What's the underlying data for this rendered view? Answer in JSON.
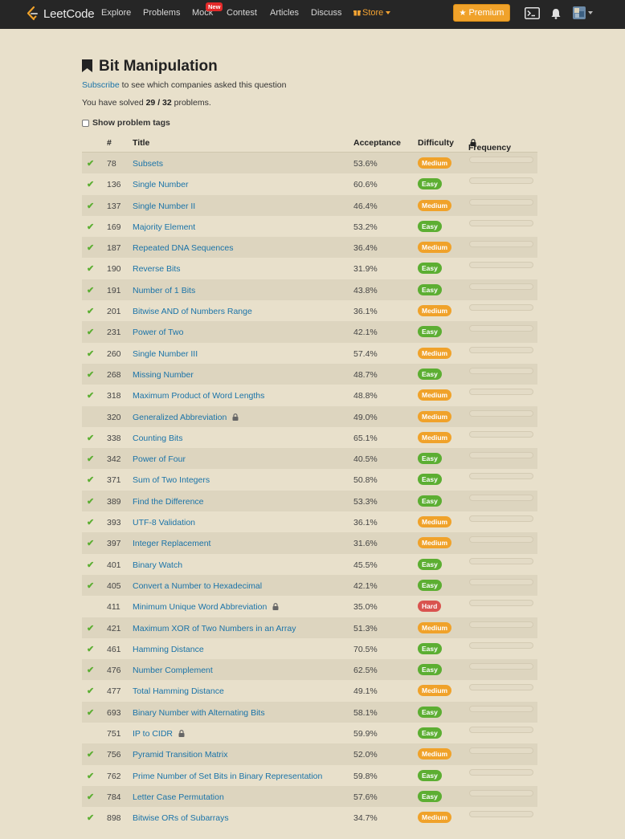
{
  "nav": {
    "brand": "LeetCode",
    "links": [
      "Explore",
      "Problems",
      "Mock",
      "Contest",
      "Articles",
      "Discuss"
    ],
    "new_badge": "New",
    "store": "Store",
    "premium": "Premium",
    "icons": [
      "console-icon",
      "bell-icon",
      "avatar"
    ]
  },
  "page": {
    "title": "Bit Manipulation",
    "subscribe_link": "Subscribe",
    "subscribe_rest": " to see which companies asked this question",
    "solved_prefix": "You have solved ",
    "solved_count": "29 / 32",
    "solved_suffix": " problems.",
    "show_tags": "Show problem tags"
  },
  "table": {
    "headers": {
      "num": "#",
      "title": "Title",
      "acceptance": "Acceptance",
      "difficulty": "Difficulty",
      "frequency": "Frequency"
    },
    "rows": [
      {
        "solved": true,
        "num": "78",
        "title": "Subsets",
        "locked": false,
        "acceptance": "53.6%",
        "difficulty": "Medium"
      },
      {
        "solved": true,
        "num": "136",
        "title": "Single Number",
        "locked": false,
        "acceptance": "60.6%",
        "difficulty": "Easy"
      },
      {
        "solved": true,
        "num": "137",
        "title": "Single Number II",
        "locked": false,
        "acceptance": "46.4%",
        "difficulty": "Medium"
      },
      {
        "solved": true,
        "num": "169",
        "title": "Majority Element",
        "locked": false,
        "acceptance": "53.2%",
        "difficulty": "Easy"
      },
      {
        "solved": true,
        "num": "187",
        "title": "Repeated DNA Sequences",
        "locked": false,
        "acceptance": "36.4%",
        "difficulty": "Medium"
      },
      {
        "solved": true,
        "num": "190",
        "title": "Reverse Bits",
        "locked": false,
        "acceptance": "31.9%",
        "difficulty": "Easy"
      },
      {
        "solved": true,
        "num": "191",
        "title": "Number of 1 Bits",
        "locked": false,
        "acceptance": "43.8%",
        "difficulty": "Easy"
      },
      {
        "solved": true,
        "num": "201",
        "title": "Bitwise AND of Numbers Range",
        "locked": false,
        "acceptance": "36.1%",
        "difficulty": "Medium"
      },
      {
        "solved": true,
        "num": "231",
        "title": "Power of Two",
        "locked": false,
        "acceptance": "42.1%",
        "difficulty": "Easy"
      },
      {
        "solved": true,
        "num": "260",
        "title": "Single Number III",
        "locked": false,
        "acceptance": "57.4%",
        "difficulty": "Medium"
      },
      {
        "solved": true,
        "num": "268",
        "title": "Missing Number",
        "locked": false,
        "acceptance": "48.7%",
        "difficulty": "Easy"
      },
      {
        "solved": true,
        "num": "318",
        "title": "Maximum Product of Word Lengths",
        "locked": false,
        "acceptance": "48.8%",
        "difficulty": "Medium"
      },
      {
        "solved": false,
        "num": "320",
        "title": "Generalized Abbreviation",
        "locked": true,
        "acceptance": "49.0%",
        "difficulty": "Medium"
      },
      {
        "solved": true,
        "num": "338",
        "title": "Counting Bits",
        "locked": false,
        "acceptance": "65.1%",
        "difficulty": "Medium"
      },
      {
        "solved": true,
        "num": "342",
        "title": "Power of Four",
        "locked": false,
        "acceptance": "40.5%",
        "difficulty": "Easy"
      },
      {
        "solved": true,
        "num": "371",
        "title": "Sum of Two Integers",
        "locked": false,
        "acceptance": "50.8%",
        "difficulty": "Easy"
      },
      {
        "solved": true,
        "num": "389",
        "title": "Find the Difference",
        "locked": false,
        "acceptance": "53.3%",
        "difficulty": "Easy"
      },
      {
        "solved": true,
        "num": "393",
        "title": "UTF-8 Validation",
        "locked": false,
        "acceptance": "36.1%",
        "difficulty": "Medium"
      },
      {
        "solved": true,
        "num": "397",
        "title": "Integer Replacement",
        "locked": false,
        "acceptance": "31.6%",
        "difficulty": "Medium"
      },
      {
        "solved": true,
        "num": "401",
        "title": "Binary Watch",
        "locked": false,
        "acceptance": "45.5%",
        "difficulty": "Easy"
      },
      {
        "solved": true,
        "num": "405",
        "title": "Convert a Number to Hexadecimal",
        "locked": false,
        "acceptance": "42.1%",
        "difficulty": "Easy"
      },
      {
        "solved": false,
        "num": "411",
        "title": "Minimum Unique Word Abbreviation",
        "locked": true,
        "acceptance": "35.0%",
        "difficulty": "Hard"
      },
      {
        "solved": true,
        "num": "421",
        "title": "Maximum XOR of Two Numbers in an Array",
        "locked": false,
        "acceptance": "51.3%",
        "difficulty": "Medium"
      },
      {
        "solved": true,
        "num": "461",
        "title": "Hamming Distance",
        "locked": false,
        "acceptance": "70.5%",
        "difficulty": "Easy"
      },
      {
        "solved": true,
        "num": "476",
        "title": "Number Complement",
        "locked": false,
        "acceptance": "62.5%",
        "difficulty": "Easy"
      },
      {
        "solved": true,
        "num": "477",
        "title": "Total Hamming Distance",
        "locked": false,
        "acceptance": "49.1%",
        "difficulty": "Medium"
      },
      {
        "solved": true,
        "num": "693",
        "title": "Binary Number with Alternating Bits",
        "locked": false,
        "acceptance": "58.1%",
        "difficulty": "Easy"
      },
      {
        "solved": false,
        "num": "751",
        "title": "IP to CIDR",
        "locked": true,
        "acceptance": "59.9%",
        "difficulty": "Easy"
      },
      {
        "solved": true,
        "num": "756",
        "title": "Pyramid Transition Matrix",
        "locked": false,
        "acceptance": "52.0%",
        "difficulty": "Medium"
      },
      {
        "solved": true,
        "num": "762",
        "title": "Prime Number of Set Bits in Binary Representation",
        "locked": false,
        "acceptance": "59.8%",
        "difficulty": "Easy"
      },
      {
        "solved": true,
        "num": "784",
        "title": "Letter Case Permutation",
        "locked": false,
        "acceptance": "57.6%",
        "difficulty": "Easy"
      },
      {
        "solved": true,
        "num": "898",
        "title": "Bitwise ORs of Subarrays",
        "locked": false,
        "acceptance": "34.7%",
        "difficulty": "Medium"
      }
    ]
  },
  "colors": {
    "background": "#e8e0cb",
    "navbar": "#262626",
    "link": "#1a73a8",
    "easy": "#5cae32",
    "medium": "#f0a22a",
    "hard": "#d9534f",
    "premium": "#f0a22a"
  }
}
